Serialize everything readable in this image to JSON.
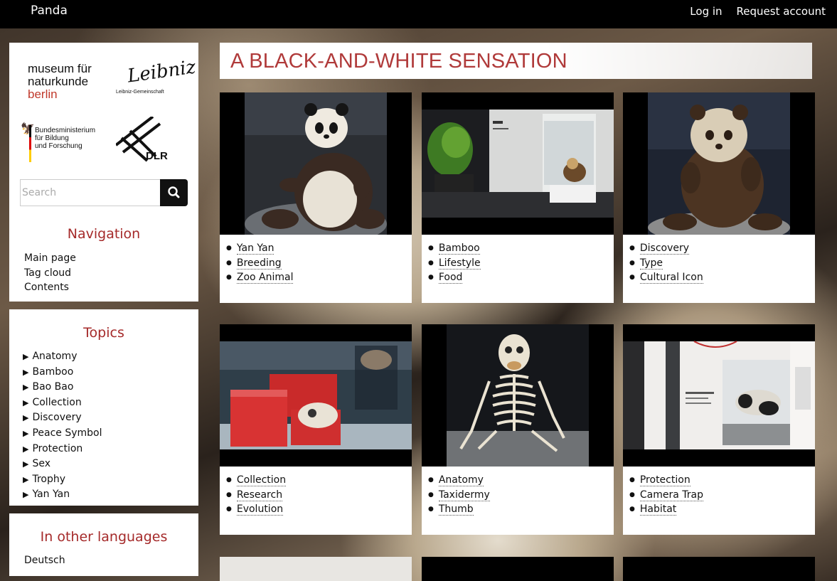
{
  "topbar": {
    "brand": "Panda",
    "login": "Log in",
    "request_account": "Request account"
  },
  "logos": {
    "mfn_line1": "museum für",
    "mfn_line2": "naturkunde",
    "mfn_line3": "berlin",
    "leibniz_signature": "Leibniz",
    "leibniz_sub": "Leibniz-Gemeinschaft",
    "bmbf_line1": "Bundesministerium",
    "bmbf_line2": "für Bildung",
    "bmbf_line3": "und Forschung",
    "dlr": "DLR"
  },
  "search": {
    "placeholder": "Search"
  },
  "navigation": {
    "title": "Navigation",
    "items": [
      "Main page",
      "Tag cloud",
      "Contents"
    ]
  },
  "topics": {
    "title": "Topics",
    "items": [
      "Anatomy",
      "Bamboo",
      "Bao Bao",
      "Collection",
      "Discovery",
      "Peace Symbol",
      "Protection",
      "Sex",
      "Trophy",
      "Yan Yan"
    ]
  },
  "languages": {
    "title": "In other languages",
    "items": [
      "Deutsch"
    ]
  },
  "page_title": "A BLACK-AND-WHITE SENSATION",
  "cards": [
    {
      "tags": [
        "Yan Yan",
        "Breeding",
        "Zoo Animal"
      ]
    },
    {
      "tags": [
        "Bamboo",
        "Lifestyle",
        "Food"
      ]
    },
    {
      "tags": [
        "Discovery",
        "Type",
        "Cultural Icon"
      ]
    },
    {
      "tags": [
        "Collection",
        "Research",
        "Evolution"
      ]
    },
    {
      "tags": [
        "Anatomy",
        "Taxidermy",
        "Thumb"
      ]
    },
    {
      "tags": [
        "Protection",
        "Camera Trap",
        "Habitat"
      ]
    }
  ],
  "colors": {
    "accent": "#a52a2a",
    "topbar": "#000000"
  }
}
